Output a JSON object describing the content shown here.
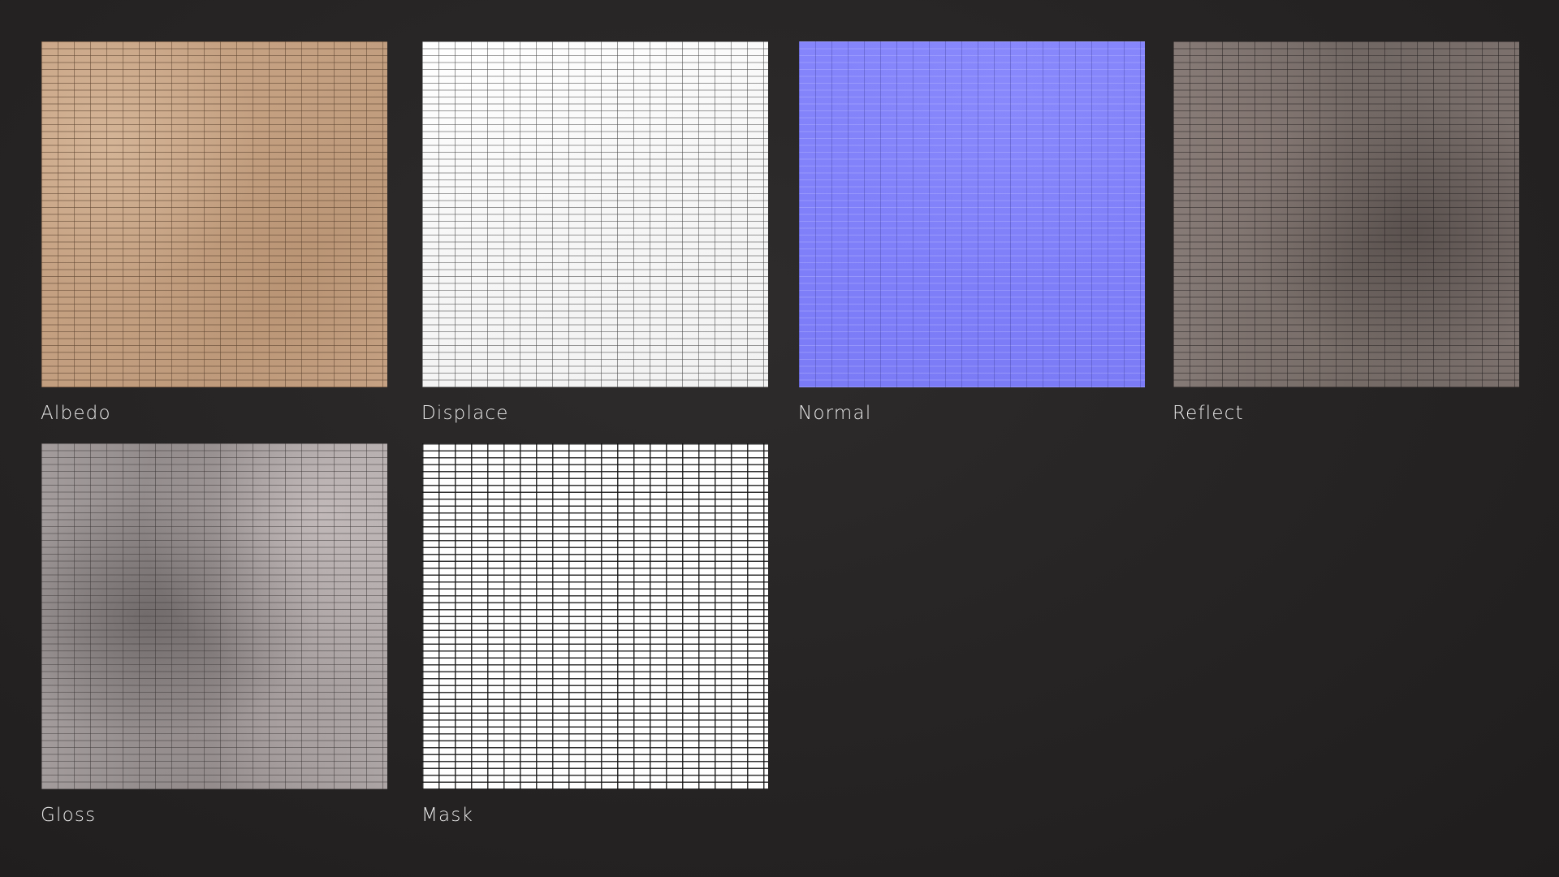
{
  "maps": [
    {
      "label": "Albedo",
      "texture": "albedo-texture",
      "color": "#c4a081"
    },
    {
      "label": "Displace",
      "texture": "displacement-texture",
      "color": "#f6f6f6"
    },
    {
      "label": "Normal",
      "texture": "normal-texture",
      "color": "#8080fa"
    },
    {
      "label": "Reflect",
      "texture": "reflection-texture",
      "color": "#7a706c"
    },
    {
      "label": "Gloss",
      "texture": "glossiness-texture",
      "color": "#9a9393"
    },
    {
      "label": "Mask",
      "texture": "mask-texture",
      "color": "#ffffff"
    }
  ],
  "background_color": "#272525"
}
